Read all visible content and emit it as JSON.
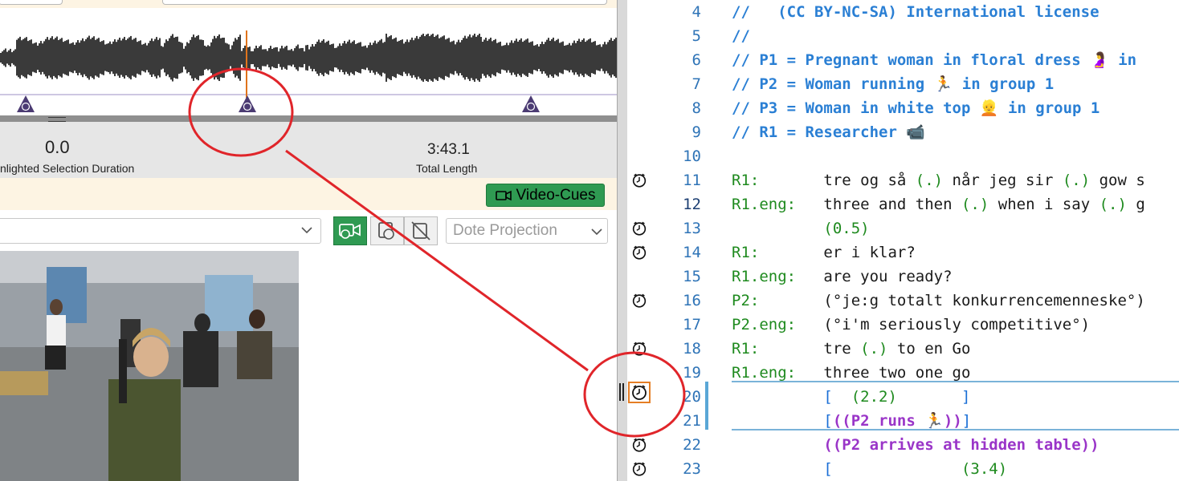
{
  "waveform": {
    "markers": [
      {
        "name": "cue-marker-1",
        "time_label": "◷"
      },
      {
        "name": "cue-marker-2",
        "time_label": "◷"
      },
      {
        "name": "cue-marker-3",
        "time_label": "◷"
      }
    ]
  },
  "info": {
    "selection_duration_value": "0.0",
    "selection_duration_label": "nlighted Selection Duration",
    "total_length_value": "3:43.1",
    "total_length_label": "Total Length"
  },
  "cue_bar": {
    "video_cues_label": "Video-Cues"
  },
  "controls": {
    "projection_placeholder": "Dote Projection"
  },
  "editor": {
    "lines": [
      {
        "num": "4",
        "segments": [
          {
            "cls": "cmt",
            "text": "//   (CC BY-NC-SA) International license"
          }
        ],
        "icon": false
      },
      {
        "num": "5",
        "segments": [
          {
            "cls": "cmt",
            "text": "//"
          }
        ],
        "icon": false
      },
      {
        "num": "6",
        "segments": [
          {
            "cls": "cmt",
            "text": "// P1 = Pregnant woman in floral dress 🤰 in"
          }
        ],
        "icon": false
      },
      {
        "num": "7",
        "segments": [
          {
            "cls": "cmt",
            "text": "// P2 = Woman running 🏃 in group 1"
          }
        ],
        "icon": false
      },
      {
        "num": "8",
        "segments": [
          {
            "cls": "cmt",
            "text": "// P3 = Woman in white top 👱 in group 1"
          }
        ],
        "icon": false
      },
      {
        "num": "9",
        "segments": [
          {
            "cls": "cmt",
            "text": "// R1 = Researcher 📹"
          }
        ],
        "icon": false
      },
      {
        "num": "10",
        "segments": [],
        "icon": false
      },
      {
        "num": "11",
        "segments": [
          {
            "cls": "spk",
            "text": "R1:       "
          },
          {
            "cls": "txt",
            "text": "tre og så "
          },
          {
            "cls": "pause",
            "text": "(.)"
          },
          {
            "cls": "txt",
            "text": " når jeg sir "
          },
          {
            "cls": "pause",
            "text": "(.)"
          },
          {
            "cls": "txt",
            "text": " gow s"
          }
        ],
        "icon": true
      },
      {
        "num": "12",
        "segments": [
          {
            "cls": "spk",
            "text": "R1.eng:   "
          },
          {
            "cls": "txt",
            "text": "three and then "
          },
          {
            "cls": "pause",
            "text": "(.)"
          },
          {
            "cls": "txt",
            "text": " when i say "
          },
          {
            "cls": "pause",
            "text": "(.)"
          },
          {
            "cls": "txt",
            "text": " g"
          }
        ],
        "icon": false,
        "current": true
      },
      {
        "num": "13",
        "segments": [
          {
            "cls": "txt",
            "text": "          "
          },
          {
            "cls": "pause",
            "text": "(0.5)"
          }
        ],
        "icon": true
      },
      {
        "num": "14",
        "segments": [
          {
            "cls": "spk",
            "text": "R1:       "
          },
          {
            "cls": "txt",
            "text": "er i klar?"
          }
        ],
        "icon": true
      },
      {
        "num": "15",
        "segments": [
          {
            "cls": "spk",
            "text": "R1.eng:   "
          },
          {
            "cls": "txt",
            "text": "are you ready?"
          }
        ],
        "icon": false
      },
      {
        "num": "16",
        "segments": [
          {
            "cls": "spk",
            "text": "P2:       "
          },
          {
            "cls": "txt",
            "text": "(°je:g totalt konkurrencemenneske°)"
          }
        ],
        "icon": true
      },
      {
        "num": "17",
        "segments": [
          {
            "cls": "spk",
            "text": "P2.eng:   "
          },
          {
            "cls": "txt",
            "text": "(°i'm seriously competitive°)"
          }
        ],
        "icon": false
      },
      {
        "num": "18",
        "segments": [
          {
            "cls": "spk",
            "text": "R1:       "
          },
          {
            "cls": "txt",
            "text": "tre "
          },
          {
            "cls": "pause",
            "text": "(.)"
          },
          {
            "cls": "txt",
            "text": " to en Go"
          }
        ],
        "icon": true
      },
      {
        "num": "19",
        "segments": [
          {
            "cls": "spk",
            "text": "R1.eng:   "
          },
          {
            "cls": "txt",
            "text": "three two one go"
          }
        ],
        "icon": false
      },
      {
        "num": "20",
        "segments": [
          {
            "cls": "txt",
            "text": "          "
          },
          {
            "cls": "brk",
            "text": "[  "
          },
          {
            "cls": "pause",
            "text": "(2.2)"
          },
          {
            "cls": "brk",
            "text": "       ]"
          }
        ],
        "icon": true,
        "selected": true
      },
      {
        "num": "21",
        "segments": [
          {
            "cls": "txt",
            "text": "          "
          },
          {
            "cls": "brk",
            "text": "["
          },
          {
            "cls": "annot",
            "text": "((P2 runs 🏃))"
          },
          {
            "cls": "brk",
            "text": "]"
          }
        ],
        "icon": false
      },
      {
        "num": "22",
        "segments": [
          {
            "cls": "txt",
            "text": "          "
          },
          {
            "cls": "annot",
            "text": "((P2 arrives at hidden table))"
          }
        ],
        "icon": true
      },
      {
        "num": "23",
        "segments": [
          {
            "cls": "txt",
            "text": "          "
          },
          {
            "cls": "brk",
            "text": "[              "
          },
          {
            "cls": "pause",
            "text": "(3.4)"
          }
        ],
        "icon": true
      }
    ]
  },
  "colors": {
    "accent_green": "#2f9a52",
    "annotation_red": "#e0252a",
    "playhead_orange": "#e0741c",
    "marker_purple": "#4b3b73"
  }
}
